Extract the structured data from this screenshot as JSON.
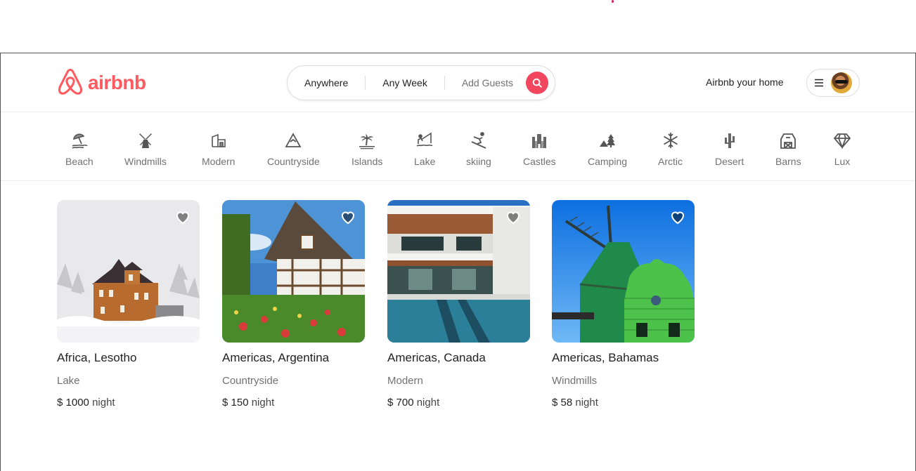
{
  "brand": {
    "name": "airbnb",
    "color": "#ff5a5f"
  },
  "search": {
    "where": "Anywhere",
    "when": "Any Week",
    "guests": "Add Guests",
    "button_color": "#f1465e"
  },
  "header": {
    "host_link": "Airbnb your home"
  },
  "categories": [
    {
      "label": "Beach",
      "icon": "beach-umbrella-icon"
    },
    {
      "label": "Windmills",
      "icon": "windmill-icon"
    },
    {
      "label": "Modern",
      "icon": "modern-house-icon"
    },
    {
      "label": "Countryside",
      "icon": "mountain-icon"
    },
    {
      "label": "Islands",
      "icon": "island-palm-icon"
    },
    {
      "label": "Lake",
      "icon": "lake-fishing-icon"
    },
    {
      "label": "skiing",
      "icon": "skier-icon"
    },
    {
      "label": "Castles",
      "icon": "castle-icon"
    },
    {
      "label": "Camping",
      "icon": "tent-icon"
    },
    {
      "label": "Arctic",
      "icon": "snowflake-icon"
    },
    {
      "label": "Desert",
      "icon": "cactus-icon"
    },
    {
      "label": "Barns",
      "icon": "barn-icon"
    },
    {
      "label": "Lux",
      "icon": "diamond-icon"
    }
  ],
  "listings": [
    {
      "title": "Africa, Lesotho",
      "category": "Lake",
      "price": "$ 1000",
      "unit": "night",
      "image": "snowy-victorian-house"
    },
    {
      "title": "Americas, Argentina",
      "category": "Countryside",
      "price": "$ 150",
      "unit": "night",
      "image": "timber-cottage-garden"
    },
    {
      "title": "Americas, Canada",
      "category": "Modern",
      "price": "$ 700",
      "unit": "night",
      "image": "modern-villa-pool"
    },
    {
      "title": "Americas, Bahamas",
      "category": "Windmills",
      "price": "$ 58",
      "unit": "night",
      "image": "green-windmill"
    }
  ]
}
